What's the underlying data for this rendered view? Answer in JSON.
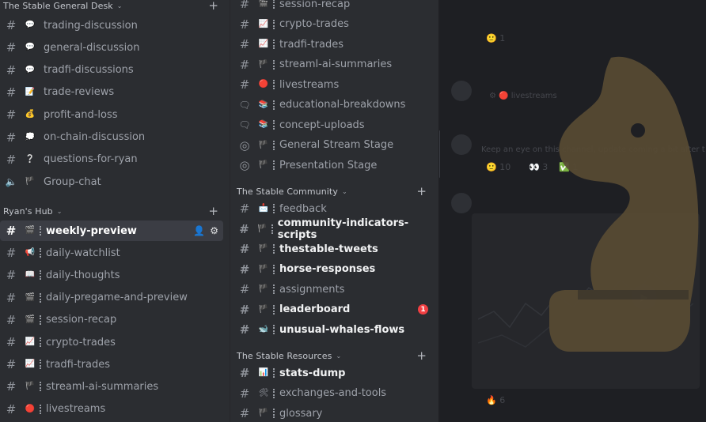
{
  "left": {
    "cat1": {
      "label": "The Stable General Desk"
    },
    "cat2": {
      "label": "Ryan's Hub"
    },
    "channels": [
      {
        "name": "trading-discussion",
        "icon": "speech-bubble-icon",
        "glyph": "💬"
      },
      {
        "name": "general-discussion",
        "icon": "speech-bubble-icon",
        "glyph": "💬"
      },
      {
        "name": "tradfi-discussions",
        "icon": "speech-bubble-icon",
        "glyph": "💬"
      },
      {
        "name": "trade-reviews",
        "icon": "memo-icon",
        "glyph": "📝"
      },
      {
        "name": "profit-and-loss",
        "icon": "money-bag-icon",
        "glyph": "💰"
      },
      {
        "name": "on-chain-discussion",
        "icon": "thought-bubble-icon",
        "glyph": "💭"
      },
      {
        "name": "questions-for-ryan",
        "icon": "question-mark-icon",
        "glyph": "❔"
      },
      {
        "name": "Group-chat",
        "icon": "purple-flag-icon",
        "glyph": "🏴"
      }
    ],
    "hub": [
      {
        "name": "weekly-preview",
        "icon": "clapper-board-icon",
        "glyph": "🎬"
      },
      {
        "name": "daily-watchlist",
        "icon": "megaphone-icon",
        "glyph": "📢"
      },
      {
        "name": "daily-thoughts",
        "icon": "open-book-icon",
        "glyph": "📖"
      },
      {
        "name": "daily-pregame-and-preview",
        "icon": "clapper-board-icon",
        "glyph": "🎬"
      },
      {
        "name": "session-recap",
        "icon": "clapper-board-icon",
        "glyph": "🎬"
      },
      {
        "name": "crypto-trades",
        "icon": "chart-increasing-icon",
        "glyph": "📈"
      },
      {
        "name": "tradfi-trades",
        "icon": "chart-increasing-icon",
        "glyph": "📈"
      },
      {
        "name": "streaml-ai-summaries",
        "icon": "purple-flag-icon",
        "glyph": "🏴"
      },
      {
        "name": "livestreams",
        "icon": "red-circle-icon",
        "glyph": "🔴"
      }
    ]
  },
  "mid": {
    "top": [
      {
        "name": "session-recap",
        "icon": "clapper-board-icon",
        "glyph": "🎬",
        "kind": "text"
      },
      {
        "name": "crypto-trades",
        "icon": "chart-increasing-icon",
        "glyph": "📈",
        "kind": "text"
      },
      {
        "name": "tradfi-trades",
        "icon": "chart-increasing-icon",
        "glyph": "📈",
        "kind": "text"
      },
      {
        "name": "streaml-ai-summaries",
        "icon": "purple-flag-icon",
        "glyph": "🏴",
        "kind": "text"
      },
      {
        "name": "livestreams",
        "icon": "red-circle-icon",
        "glyph": "🔴",
        "kind": "text"
      },
      {
        "name": "educational-breakdowns",
        "icon": "books-icon",
        "glyph": "📚",
        "kind": "forum"
      },
      {
        "name": "concept-uploads",
        "icon": "books-icon",
        "glyph": "📚",
        "kind": "forum"
      },
      {
        "name": "General Stream Stage",
        "icon": "purple-flag-icon",
        "glyph": "🏴",
        "kind": "stage"
      },
      {
        "name": "Presentation Stage",
        "icon": "purple-flag-icon",
        "glyph": "🏴",
        "kind": "stage"
      }
    ],
    "cat_community": {
      "label": "The Stable Community"
    },
    "community": [
      {
        "name": "feedback",
        "icon": "envelope-icon",
        "glyph": "📩",
        "unread": false
      },
      {
        "name": "community-indicators-scripts",
        "icon": "purple-flag-icon",
        "glyph": "🏴",
        "unread": true
      },
      {
        "name": "thestable-tweets",
        "icon": "purple-flag-icon",
        "glyph": "🏴",
        "unread": true
      },
      {
        "name": "horse-responses",
        "icon": "purple-flag-icon",
        "glyph": "🏴",
        "unread": true
      },
      {
        "name": "assignments",
        "icon": "purple-flag-icon",
        "glyph": "🏴",
        "unread": false
      },
      {
        "name": "leaderboard",
        "icon": "purple-flag-icon",
        "glyph": "🏴",
        "unread": true,
        "badge": "1"
      },
      {
        "name": "unusual-whales-flows",
        "icon": "whale-icon",
        "glyph": "🐋",
        "unread": true
      }
    ],
    "cat_resources": {
      "label": "The Stable Resources"
    },
    "resources": [
      {
        "name": "stats-dump",
        "icon": "bar-chart-icon",
        "glyph": "📊",
        "unread": true
      },
      {
        "name": "exchanges-and-tools",
        "icon": "hammer-wrench-icon",
        "glyph": "🛠",
        "unread": false
      },
      {
        "name": "glossary",
        "icon": "purple-flag-icon",
        "glyph": "🏴",
        "unread": false
      }
    ]
  },
  "chat": {
    "reaction_count_1": "1",
    "msg1_text": "livestreams",
    "msg2_text": "Keep an eye on this channel, update coming a bit after t",
    "reacts": [
      "10",
      "3",
      "1"
    ],
    "reaction_count_last": "6"
  },
  "colors": {
    "selected_bg": "#3b3d44",
    "badge": "#f23f42",
    "sidebar": "#2b2d31",
    "logo": "#b59a5e"
  }
}
